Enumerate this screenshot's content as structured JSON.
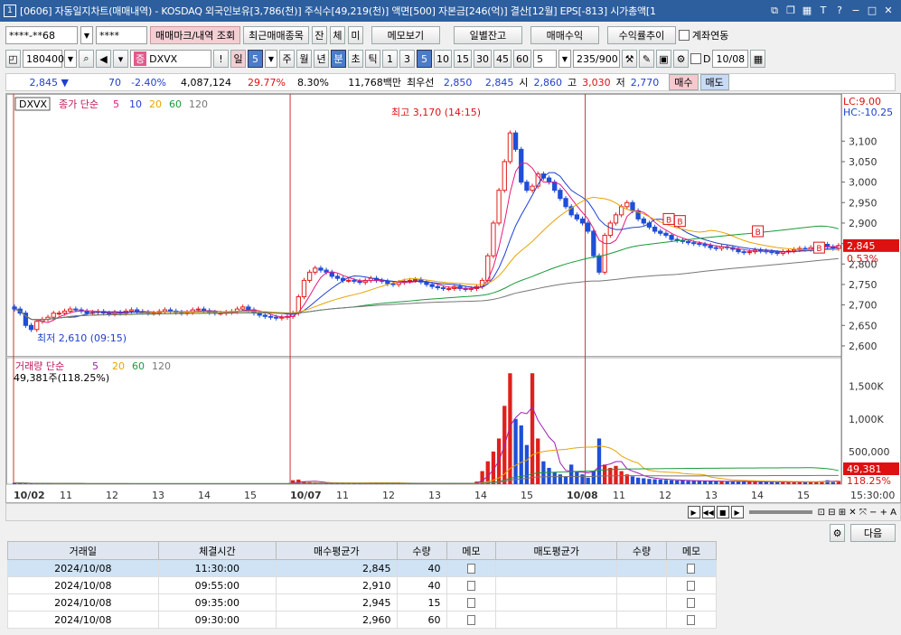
{
  "window": {
    "title": "[0606] 자동일지차트(매매내역) - KOSDAQ 외국인보유[3,786(천)] 주식수[49,219(천)] 액면[500] 자본금[246(억)] 결산[12월] EPS[-813] 시가총액[1",
    "badge": "1"
  },
  "toolbar1": {
    "account": "****-**68",
    "password": "****",
    "btn_mark": "매매마크/내역 조회",
    "btn_recent": "최근매매종목",
    "btn_jan": "잔",
    "btn_che": "체",
    "btn_mi": "미",
    "btn_memo": "메모보기",
    "btn_daily": "일별잔고",
    "btn_profit": "매매수익",
    "btn_rate": "수익률추이",
    "chk_link": "계좌연동"
  },
  "toolbar2": {
    "code": "180400",
    "badge": "증",
    "name": "DXVX",
    "excl": "!",
    "period": "일",
    "period_n": "5",
    "p_week": "주",
    "p_month": "월",
    "p_year": "년",
    "p_min": "분",
    "p_sec": "초",
    "p_tick": "틱",
    "intervals": [
      "1",
      "3",
      "5",
      "10",
      "15",
      "30",
      "45",
      "60"
    ],
    "interval_sel": "5",
    "count": "5",
    "range": "235/900",
    "chk_d": "D",
    "date": "10/08"
  },
  "quote": {
    "price": "2,845 ▼",
    "change": "70",
    "pct": "-2.40%",
    "volume": "4,087,124",
    "ratio": "29.77%",
    "ratio2": "8.30%",
    "amount": "11,768백만",
    "best_label": "최우선",
    "ask": "2,850",
    "bid": "2,845",
    "open_label": "시",
    "open": "2,860",
    "high_label": "고",
    "high": "3,030",
    "low_label": "저",
    "low": "2,770",
    "btn_buy": "매수",
    "btn_sell": "매도"
  },
  "chart_data": {
    "type": "candlestick",
    "symbol": "DXVX",
    "price_legend": {
      "label": "종가 단순",
      "ma": [
        "5",
        "10",
        "20",
        "60",
        "120"
      ]
    },
    "volume_legend": {
      "label": "거래량 단순",
      "ma": [
        "5",
        "20",
        "60",
        "120"
      ],
      "current": "49,381주(118.25%)"
    },
    "annotations": {
      "high": "최고 3,170 (14:15)",
      "low": "최저 2,610 (09:15)",
      "lc": "LC:9.00",
      "hc": "HC:-10.25",
      "last_price": "2,845",
      "last_pct": "0.53%",
      "last_vol": "49,381",
      "last_vol_pct": "118.25%",
      "buy_marks": [
        "B",
        "B",
        "B",
        "B"
      ]
    },
    "y_ticks": [
      "3,100",
      "3,050",
      "3,000",
      "2,950",
      "2,900",
      "2,850",
      "2,800",
      "2,750",
      "2,700",
      "2,650",
      "2,600"
    ],
    "vol_ticks": [
      "1,500K",
      "1,000K",
      "500,000"
    ],
    "x_labels": [
      "10/02",
      "11",
      "12",
      "13",
      "14",
      "15",
      "10/07",
      "11",
      "12",
      "13",
      "14",
      "15",
      "10/08",
      "11",
      "12",
      "13",
      "14",
      "15",
      "15:30:00"
    ],
    "ylim": [
      2580,
      3180
    ],
    "close": [
      2690,
      2680,
      2650,
      2640,
      2660,
      2665,
      2670,
      2680,
      2680,
      2685,
      2690,
      2688,
      2685,
      2680,
      2682,
      2684,
      2680,
      2678,
      2682,
      2680,
      2685,
      2688,
      2684,
      2682,
      2680,
      2680,
      2684,
      2688,
      2685,
      2682,
      2680,
      2682,
      2688,
      2690,
      2686,
      2682,
      2680,
      2680,
      2682,
      2684,
      2690,
      2695,
      2688,
      2680,
      2675,
      2672,
      2670,
      2668,
      2670,
      2672,
      2680,
      2720,
      2760,
      2780,
      2790,
      2785,
      2780,
      2770,
      2765,
      2760,
      2760,
      2758,
      2755,
      2760,
      2765,
      2760,
      2758,
      2752,
      2750,
      2755,
      2758,
      2760,
      2762,
      2756,
      2750,
      2745,
      2742,
      2740,
      2740,
      2745,
      2740,
      2738,
      2740,
      2745,
      2760,
      2820,
      2900,
      2980,
      3050,
      3120,
      3080,
      3000,
      2980,
      2990,
      3020,
      3010,
      3000,
      2980,
      2960,
      2940,
      2920,
      2910,
      2900,
      2880,
      2820,
      2780,
      2870,
      2900,
      2920,
      2940,
      2950,
      2930,
      2910,
      2900,
      2890,
      2880,
      2875,
      2870,
      2860,
      2858,
      2855,
      2852,
      2850,
      2848,
      2845,
      2840,
      2838,
      2842,
      2840,
      2836,
      2830,
      2828,
      2830,
      2834,
      2832,
      2830,
      2828,
      2826,
      2830,
      2832,
      2835,
      2838,
      2836,
      2840,
      2845,
      2848,
      2842,
      2838,
      2845
    ],
    "volume_k": [
      20,
      15,
      10,
      8,
      10,
      9,
      8,
      8,
      7,
      8,
      9,
      7,
      8,
      6,
      7,
      8,
      6,
      7,
      8,
      6,
      7,
      8,
      7,
      6,
      7,
      8,
      7,
      6,
      8,
      7,
      6,
      7,
      8,
      9,
      7,
      6,
      8,
      6,
      7,
      6,
      8,
      9,
      7,
      6,
      8,
      7,
      6,
      7,
      8,
      9,
      60,
      70,
      40,
      30,
      25,
      20,
      18,
      15,
      14,
      12,
      15,
      12,
      10,
      12,
      11,
      10,
      9,
      12,
      10,
      9,
      8,
      10,
      9,
      11,
      9,
      8,
      10,
      9,
      8,
      12,
      10,
      9,
      8,
      40,
      200,
      350,
      500,
      700,
      1200,
      1700,
      1000,
      900,
      600,
      1700,
      700,
      350,
      250,
      180,
      150,
      120,
      300,
      200,
      150,
      100,
      200,
      700,
      300,
      250,
      280,
      200,
      150,
      120,
      100,
      90,
      80,
      75,
      70,
      65,
      60,
      55,
      55,
      50,
      50,
      48,
      46,
      45,
      44,
      43,
      42,
      41,
      40,
      40,
      38,
      38,
      37,
      36,
      35,
      34,
      34,
      33,
      32,
      35,
      34,
      36,
      40,
      44,
      60,
      48,
      49
    ],
    "day_split_index": [
      50,
      103
    ]
  },
  "status_icons": [
    "play",
    "rewind",
    "stop",
    "forward"
  ],
  "lower": {
    "next": "다음",
    "headers": [
      "거래일",
      "체결시간",
      "매수평균가",
      "수량",
      "메모",
      "매도평균가",
      "수량",
      "메모"
    ],
    "rows": [
      {
        "date": "2024/10/08",
        "time": "11:30:00",
        "price": "2,845",
        "qty": "40"
      },
      {
        "date": "2024/10/08",
        "time": "09:55:00",
        "price": "2,910",
        "qty": "40"
      },
      {
        "date": "2024/10/08",
        "time": "09:35:00",
        "price": "2,945",
        "qty": "15"
      },
      {
        "date": "2024/10/08",
        "time": "09:30:00",
        "price": "2,960",
        "qty": "60"
      }
    ]
  }
}
